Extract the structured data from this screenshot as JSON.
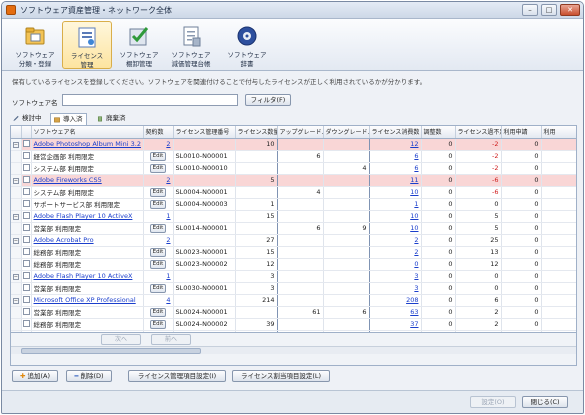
{
  "window": {
    "title": "ソフトウェア資産管理・ネットワーク全体",
    "controls": {
      "minimize": "–",
      "restore": "□",
      "close": "✕"
    }
  },
  "ribbon": {
    "buttons": [
      {
        "label_1": "ソフトウェア",
        "label_2": "分類・登録",
        "icon": "software-classify-icon",
        "active": false
      },
      {
        "label_1": "ライセンス",
        "label_2": "管理",
        "icon": "license-manage-icon",
        "active": true
      },
      {
        "label_1": "ソフトウェア",
        "label_2": "棚卸管理",
        "icon": "inventory-check-icon",
        "active": false
      },
      {
        "label_1": "ソフトウェア",
        "label_2": "減価管理台帳",
        "icon": "ledger-icon",
        "active": false
      },
      {
        "label_1": "ソフトウェア",
        "label_2": "辞書",
        "icon": "dictionary-icon",
        "active": false
      }
    ]
  },
  "description": "保有しているライセンスを登録してください。ソフトウェアを関連付けることで付与したライセンスが正しく利用されているかが分かります。",
  "filter": {
    "label": "ソフトウェア名",
    "value": "",
    "button": "フィルタ(F)"
  },
  "tabs": [
    {
      "label": "検討中",
      "icon": "pen-icon",
      "active": false
    },
    {
      "label": "導入済",
      "icon": "box-icon",
      "active": true
    },
    {
      "label": "廃棄済",
      "icon": "trash-icon",
      "active": false
    }
  ],
  "table": {
    "columns": [
      "",
      "",
      "ソフトウェア名",
      "契約数",
      "ライセンス管理番号",
      "ライセンス数量",
      "アップグレード...",
      "ダウングレード...",
      "ライセンス消費数",
      "調整数",
      "ライセンス過不足",
      "利用申請",
      "利用"
    ],
    "edit_label": "Edit",
    "rows": [
      {
        "type": "product",
        "name": "Adobe Photoshop Album Mini 3.2",
        "contract": "2",
        "mgmt": "",
        "qty": "10",
        "up": "",
        "down": "",
        "used": "12",
        "adj": "0",
        "diff": "-2",
        "req": "0",
        "use": "0",
        "pink": true
      },
      {
        "type": "dept",
        "name": "経営企画部 利用限定",
        "contract": "",
        "mgmt": "SL0010-N00001",
        "qty": "",
        "up": "6",
        "down": "",
        "used": "6",
        "adj": "0",
        "diff": "-2",
        "req": "0",
        "use": "0",
        "pink": false
      },
      {
        "type": "dept",
        "name": "システム部 利用限定",
        "contract": "",
        "mgmt": "SL0010-N00010",
        "qty": "",
        "up": "",
        "down": "4",
        "used": "6",
        "adj": "0",
        "diff": "-2",
        "req": "0",
        "use": "0",
        "pink": false
      },
      {
        "type": "product",
        "name": "Adobe Fireworks CS5",
        "contract": "2",
        "mgmt": "",
        "qty": "5",
        "up": "",
        "down": "",
        "used": "11",
        "adj": "0",
        "diff": "-6",
        "req": "0",
        "use": "0",
        "pink": true
      },
      {
        "type": "dept",
        "name": "システム部 利用限定",
        "contract": "",
        "mgmt": "SL0004-N00001",
        "qty": "",
        "up": "4",
        "down": "",
        "used": "10",
        "adj": "0",
        "diff": "-6",
        "req": "0",
        "use": "0",
        "pink": false
      },
      {
        "type": "dept",
        "name": "サポートサービス部 利用限定",
        "contract": "",
        "mgmt": "SL0004-N00003",
        "qty": "1",
        "up": "",
        "down": "",
        "used": "1",
        "adj": "0",
        "diff": "0",
        "req": "0",
        "use": "0",
        "pink": false
      },
      {
        "type": "product",
        "name": "Adobe Flash Player 10 ActiveX",
        "contract": "1",
        "mgmt": "",
        "qty": "15",
        "up": "",
        "down": "",
        "used": "10",
        "adj": "0",
        "diff": "5",
        "req": "0",
        "use": "0",
        "pink": false
      },
      {
        "type": "dept",
        "name": "営業部 利用限定",
        "contract": "",
        "mgmt": "SL0014-N00001",
        "qty": "",
        "up": "6",
        "down": "9",
        "used": "10",
        "adj": "0",
        "diff": "5",
        "req": "0",
        "use": "0",
        "pink": false
      },
      {
        "type": "product",
        "name": "Adobe Acrobat Pro",
        "contract": "2",
        "mgmt": "",
        "qty": "27",
        "up": "",
        "down": "",
        "used": "2",
        "adj": "0",
        "diff": "25",
        "req": "0",
        "use": "0",
        "pink": false
      },
      {
        "type": "dept",
        "name": "総務部 利用限定",
        "contract": "",
        "mgmt": "SL0023-N00001",
        "qty": "15",
        "up": "",
        "down": "",
        "used": "2",
        "adj": "0",
        "diff": "13",
        "req": "0",
        "use": "0",
        "pink": false
      },
      {
        "type": "dept",
        "name": "総務部 利用限定",
        "contract": "",
        "mgmt": "SL0023-N00002",
        "qty": "12",
        "up": "",
        "down": "",
        "used": "0",
        "adj": "0",
        "diff": "12",
        "req": "0",
        "use": "0",
        "pink": false
      },
      {
        "type": "product",
        "name": "Adobe Flash Player 10 ActiveX",
        "contract": "1",
        "mgmt": "",
        "qty": "3",
        "up": "",
        "down": "",
        "used": "3",
        "adj": "0",
        "diff": "0",
        "req": "0",
        "use": "0",
        "pink": false
      },
      {
        "type": "dept",
        "name": "営業部 利用限定",
        "contract": "",
        "mgmt": "SL0030-N00001",
        "qty": "3",
        "up": "",
        "down": "",
        "used": "3",
        "adj": "0",
        "diff": "0",
        "req": "0",
        "use": "0",
        "pink": false
      },
      {
        "type": "product",
        "name": "Microsoft Office XP Professional",
        "contract": "4",
        "mgmt": "",
        "qty": "214",
        "up": "",
        "down": "",
        "used": "208",
        "adj": "0",
        "diff": "6",
        "req": "0",
        "use": "0",
        "pink": false
      },
      {
        "type": "dept",
        "name": "営業部 利用限定",
        "contract": "",
        "mgmt": "SL0024-N00001",
        "qty": "",
        "up": "61",
        "down": "6",
        "used": "63",
        "adj": "0",
        "diff": "2",
        "req": "0",
        "use": "0",
        "pink": false
      },
      {
        "type": "dept",
        "name": "総務部 利用限定",
        "contract": "",
        "mgmt": "SL0024-N00002",
        "qty": "39",
        "up": "",
        "down": "",
        "used": "37",
        "adj": "0",
        "diff": "2",
        "req": "0",
        "use": "0",
        "pink": false
      },
      {
        "type": "dept",
        "name": "サポート部 利用限定",
        "contract": "",
        "mgmt": "SL0024-N00003",
        "qty": "60",
        "up": "",
        "down": "",
        "used": "60",
        "adj": "0",
        "diff": "0",
        "req": "0",
        "use": "0",
        "pink": false
      },
      {
        "type": "dept",
        "name": "システム部 利用限定",
        "contract": "",
        "mgmt": "SL0024-N00004",
        "qty": "50",
        "up": "",
        "down": "",
        "used": "48",
        "adj": "0",
        "diff": "2",
        "req": "0",
        "use": "0",
        "pink": false
      }
    ]
  },
  "grid_nav": {
    "prev": "次へ",
    "next": "前へ"
  },
  "actions": {
    "add": "追加(A)",
    "delete": "削除(D)",
    "license_settings": "ライセンス管理項目設定(I)",
    "license_allocation": "ライセンス割当項目設定(L)"
  },
  "footer": {
    "ok": "設定(O)",
    "close": "閉じる(C)"
  },
  "colors": {
    "accent": "#1a3ecc",
    "shortage_row": "#f9d6d6",
    "negative": "#d02020"
  }
}
